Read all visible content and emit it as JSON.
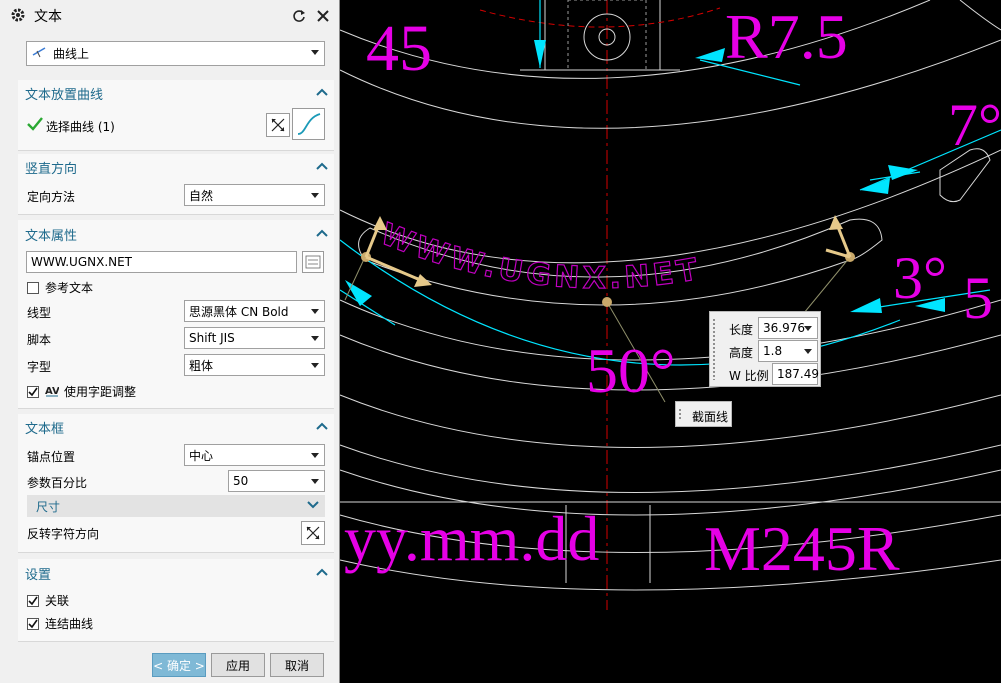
{
  "dialog": {
    "title": "文本",
    "type_value": "曲线上",
    "sections": {
      "placement_curve": {
        "header": "文本放置曲线",
        "select_label": "选择曲线 (1)"
      },
      "vertical": {
        "header": "竖直方向",
        "method_label": "定向方法",
        "method_value": "自然"
      },
      "props": {
        "header": "文本属性",
        "text_value": "WWW.UGNX.NET",
        "ref_text_label": "参考文本",
        "line_type_label": "线型",
        "line_type_value": "思源黑体 CN Bold",
        "script_label": "脚本",
        "script_value": "Shift JIS",
        "font_style_label": "字型",
        "font_style_value": "粗体",
        "kerning_label": "使用字距调整"
      },
      "frame": {
        "header": "文本框",
        "anchor_label": "锚点位置",
        "anchor_value": "中心",
        "param_label": "参数百分比",
        "param_value": "50",
        "size_label": "尺寸",
        "reverse_label": "反转字符方向"
      },
      "settings": {
        "header": "设置",
        "assoc_label": "关联",
        "join_label": "连结曲线"
      }
    },
    "buttons": {
      "ok": "< 确定 >",
      "apply": "应用",
      "cancel": "取消"
    }
  },
  "canvas": {
    "dims": {
      "d45": "45",
      "r75": "R7.5",
      "d7deg": "7°",
      "d3deg": "3°",
      "d5": "5",
      "d50deg": "50°",
      "yymmdd": "yy.mm.dd",
      "m245r": "M245R"
    },
    "curve_text": "WWW.UGNX.NET",
    "measure": {
      "length_label": "长度",
      "length_value": "36.976",
      "height_label": "高度",
      "height_value": "1.8",
      "wscale_label": "W 比例",
      "wscale_value": "187.49"
    },
    "section_tag": "截面线"
  },
  "colors": {
    "accent": "#1e6a8c",
    "dimension": "#e600e6",
    "cyan": "#00e5ff",
    "red_center": "#d40000",
    "handle": "#c9a96a"
  }
}
